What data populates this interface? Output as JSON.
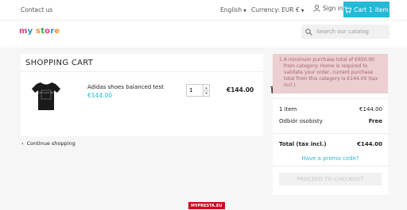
{
  "topbar": {
    "contact": "Contact us",
    "language": "English",
    "currency_label": "Currency: EUR €",
    "sign_in": "Sign in",
    "cart_label": "Cart",
    "cart_count": "1",
    "cart_item_word": "item"
  },
  "header": {
    "logo": {
      "m": "m",
      "y": "y",
      "s": "s",
      "t": "t",
      "o": "o",
      "r": "r",
      "e": "e"
    },
    "search_placeholder": "Search our catalog"
  },
  "cart": {
    "title": "SHOPPING CART",
    "product": {
      "image_text": "YOUR LOGO HERE",
      "name": "Adidas shoes balanced test",
      "price": "€144.00",
      "quantity": "1",
      "line_total": "€144.00"
    },
    "continue_shopping": "Continue shopping"
  },
  "summary": {
    "alert_bullet": "1.",
    "alert": "A minimum purchase total of €650.00 from category: Home is required to validate your order, current purchase total from this category is €144.00 (tax incl.).",
    "items_label": "1 item",
    "items_value": "€144.00",
    "shipping_label": "Odbiór osobisty",
    "shipping_value": "Free",
    "total_label": "Total (tax incl.)",
    "total_value": "€144.00",
    "promo": "Have a promo code?",
    "checkout": "PROCEED TO CHECKOUT"
  },
  "badge": "MYPRESTA.EU",
  "colors": {
    "accent": "#24b9d7",
    "alert_bg": "#ebcfd1",
    "alert_text": "#a8646b",
    "badge": "#d0021b"
  }
}
